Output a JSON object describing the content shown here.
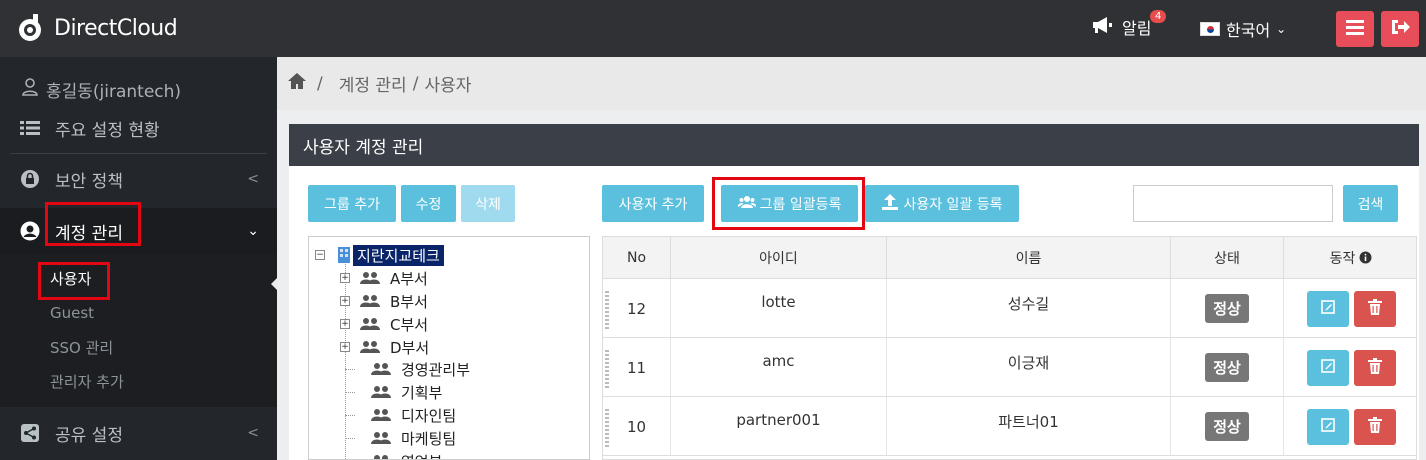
{
  "app": {
    "logo_text": "DirectCloud"
  },
  "topbar": {
    "alarm_label": "알림",
    "alarm_count": "4",
    "language": "한국어"
  },
  "sidebar": {
    "user": "홍길동(jirantech)",
    "items": [
      {
        "label": "주요 설정 현황"
      },
      {
        "label": "보안 정책"
      },
      {
        "label": "계정 관리"
      },
      {
        "label": "공유 설정"
      }
    ],
    "sub_items": [
      {
        "label": "사용자"
      },
      {
        "label": "Guest"
      },
      {
        "label": "SSO 관리"
      },
      {
        "label": "관리자 추가"
      }
    ]
  },
  "breadcrumb": {
    "items": [
      "계정 관리",
      "사용자"
    ],
    "separator": "/"
  },
  "panel": {
    "title": "사용자 계정 관리"
  },
  "buttons": {
    "group_add": "그룹 추가",
    "edit": "수정",
    "delete": "삭제",
    "user_add": "사용자 추가",
    "group_bulk": "그룹 일괄등록",
    "user_bulk": "사용자 일괄 등록",
    "search": "검색"
  },
  "tree": {
    "root": "지란지교테크",
    "nodes": [
      {
        "label": "A부서"
      },
      {
        "label": "B부서"
      },
      {
        "label": "C부서"
      },
      {
        "label": "D부서"
      },
      {
        "label": "경영관리부"
      },
      {
        "label": "기획부"
      },
      {
        "label": "디자인팀"
      },
      {
        "label": "마케팅팀"
      },
      {
        "label": "영업부"
      }
    ]
  },
  "table": {
    "headers": {
      "no": "No",
      "id": "아이디",
      "name": "이름",
      "status": "상태",
      "action": "동작"
    },
    "rows": [
      {
        "no": "12",
        "id": "lotte",
        "name": "성수길",
        "status": "정상"
      },
      {
        "no": "11",
        "id": "amc",
        "name": "이긍재",
        "status": "정상"
      },
      {
        "no": "10",
        "id": "partner001",
        "name": "파트너01",
        "status": "정상"
      }
    ]
  },
  "colors": {
    "accent": "#5bc0de",
    "danger": "#d9534f",
    "highlight": "#e30613",
    "topbar": "#2f3135",
    "sidebar": "#23262a"
  }
}
